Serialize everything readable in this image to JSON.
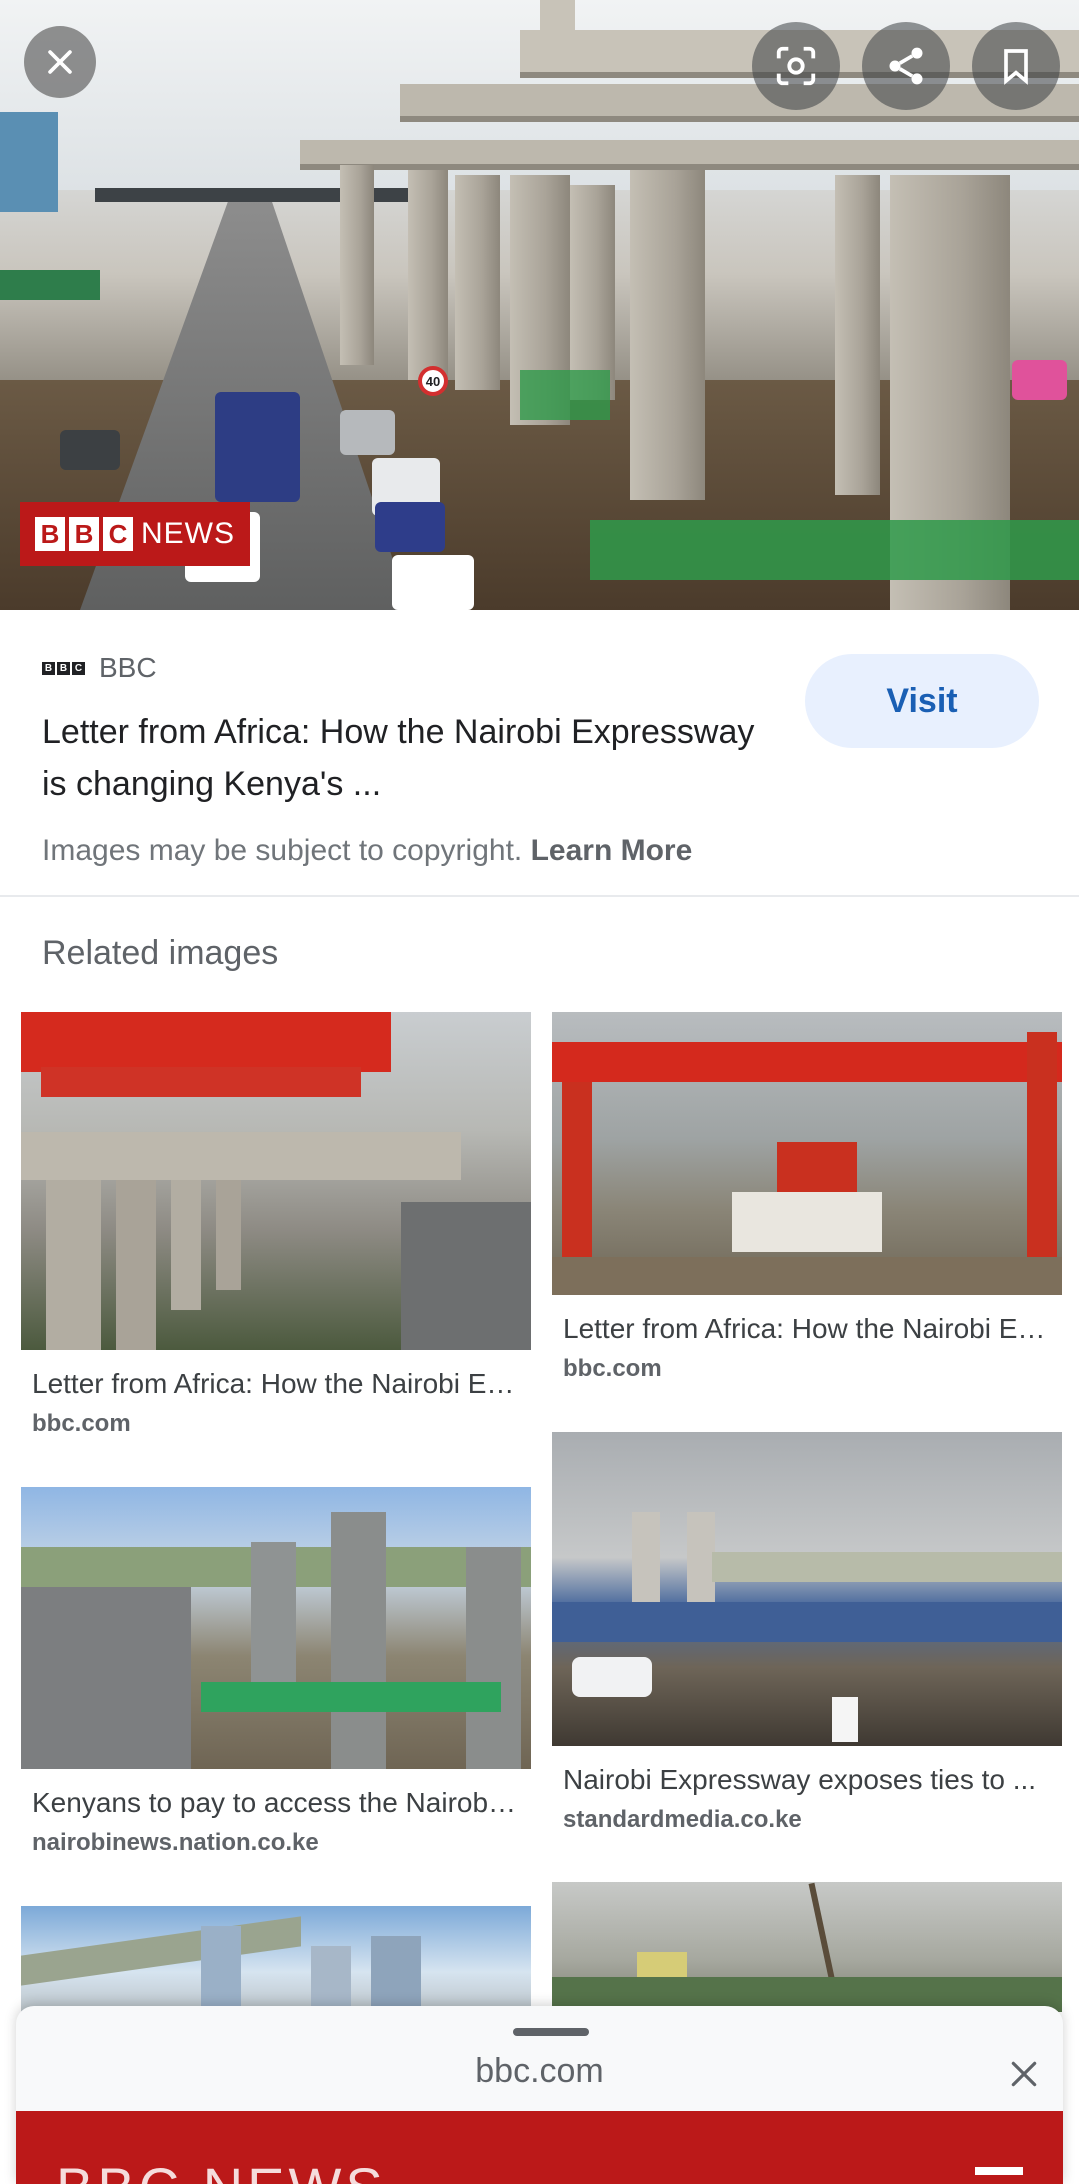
{
  "hero": {
    "watermark_blocks": [
      "B",
      "B",
      "C"
    ],
    "watermark_news": "NEWS",
    "speed_sign": "40",
    "icons": {
      "close": "close-icon",
      "lens": "lens-icon",
      "share": "share-icon",
      "bookmark": "bookmark-icon"
    }
  },
  "source": {
    "logo_blocks": [
      "B",
      "B",
      "C"
    ],
    "name": "BBC",
    "title": "Letter from Africa: How the Nairobi Expressway is changing Kenya's ...",
    "visit_label": "Visit",
    "copyright_text": "Images may be subject to copyright.",
    "learn_more": "Learn More"
  },
  "related": {
    "heading": "Related images",
    "items": [
      {
        "title": "Letter from Africa: How the Nairobi Expressway is changing Kenya's ...",
        "domain": "bbc.com"
      },
      {
        "title": "Letter from Africa: How the Nairobi Expressway is changing Kenya's ...",
        "domain": "bbc.com"
      },
      {
        "title": "Kenyans to pay to access the Nairobi Expressway",
        "domain": "nairobinews.nation.co.ke"
      },
      {
        "title": "Nairobi Expressway exposes ties to ...",
        "domain": "standardmedia.co.ke"
      }
    ]
  },
  "sheet": {
    "url": "bbc.com",
    "preview_text": "BBC NEWS"
  },
  "colors": {
    "bbc_red": "#bb1919",
    "visit_bg": "#e8f0fe",
    "visit_text": "#1a5fb4"
  }
}
